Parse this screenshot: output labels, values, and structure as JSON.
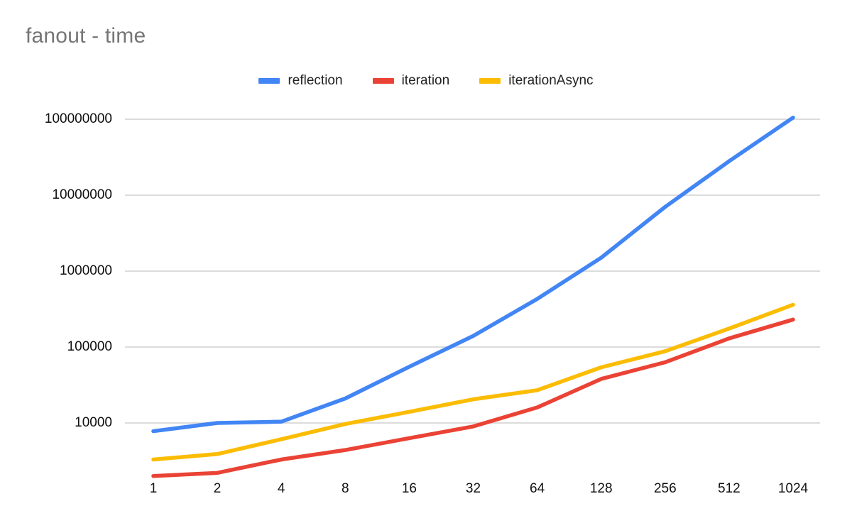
{
  "chart_data": {
    "type": "line",
    "title": "fanout - time",
    "xlabel": "",
    "ylabel": "",
    "x_scale": "log2-categorical",
    "y_scale": "log10",
    "grid": "horizontal",
    "legend_position": "top-center",
    "categories": [
      1,
      2,
      4,
      8,
      16,
      32,
      64,
      128,
      256,
      512,
      1024
    ],
    "category_labels": [
      "1",
      "2",
      "4",
      "8",
      "16",
      "32",
      "64",
      "128",
      "256",
      "512",
      "1024"
    ],
    "y_ticks": [
      10000,
      100000,
      1000000,
      10000000,
      100000000
    ],
    "y_tick_labels": [
      "10000",
      "100000",
      "1000000",
      "10000000",
      "100000000"
    ],
    "ylim": [
      3000,
      100000000
    ],
    "series": [
      {
        "name": "reflection",
        "color": "#4285F4",
        "values": [
          7800,
          10000,
          10400,
          21000,
          55000,
          140000,
          430000,
          1500000,
          7000000,
          28000000,
          105000000
        ]
      },
      {
        "name": "iteration",
        "color": "#EA4335",
        "values": [
          2000,
          2200,
          3300,
          4400,
          6300,
          9000,
          16000,
          38000,
          63000,
          130000,
          230000
        ]
      },
      {
        "name": "iterationAsync",
        "color": "#FBBC04",
        "values": [
          3300,
          3900,
          6100,
          9700,
          14000,
          20500,
          27000,
          54000,
          88000,
          175000,
          360000
        ]
      }
    ]
  },
  "legend": {
    "items": [
      {
        "label": "reflection",
        "color": "#4285F4"
      },
      {
        "label": "iteration",
        "color": "#EA4335"
      },
      {
        "label": "iterationAsync",
        "color": "#FBBC04"
      }
    ]
  },
  "axes": {
    "y_labels": [
      "100000000",
      "10000000",
      "1000000",
      "100000",
      "10000"
    ],
    "x_labels": [
      "1",
      "2",
      "4",
      "8",
      "16",
      "32",
      "64",
      "128",
      "256",
      "512",
      "1024"
    ]
  }
}
